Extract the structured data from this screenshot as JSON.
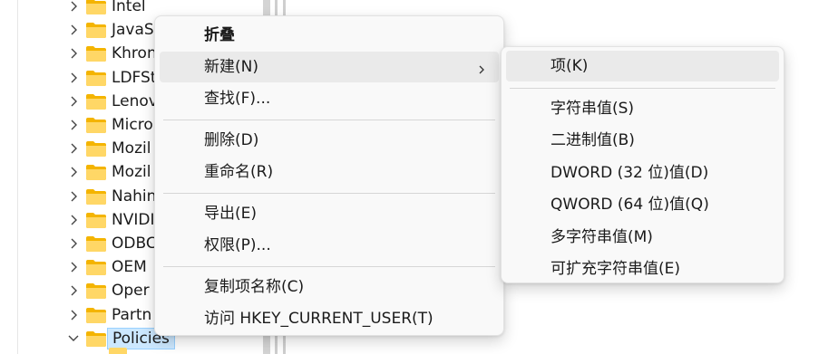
{
  "tree": {
    "items": [
      {
        "label": "Intel",
        "selected": false
      },
      {
        "label": "JavaS",
        "selected": false
      },
      {
        "label": "Khron",
        "selected": false
      },
      {
        "label": "LDFSt",
        "selected": false
      },
      {
        "label": "Lenov",
        "selected": false
      },
      {
        "label": "Micro",
        "selected": false
      },
      {
        "label": "Mozil",
        "selected": false
      },
      {
        "label": "Mozil",
        "selected": false
      },
      {
        "label": "Nahin",
        "selected": false
      },
      {
        "label": "NVIDI",
        "selected": false
      },
      {
        "label": "ODBC",
        "selected": false
      },
      {
        "label": "OEM",
        "selected": false
      },
      {
        "label": "Oper",
        "selected": false
      },
      {
        "label": "Partn",
        "selected": false
      },
      {
        "label": "Policies",
        "selected": true
      }
    ]
  },
  "context_menu": {
    "items": [
      {
        "label": "折叠",
        "bold": true
      },
      {
        "label": "新建(N)",
        "submenu": true,
        "hover": true
      },
      {
        "label": "查找(F)..."
      },
      {
        "separator": true
      },
      {
        "label": "删除(D)"
      },
      {
        "label": "重命名(R)"
      },
      {
        "separator": true
      },
      {
        "label": "导出(E)"
      },
      {
        "label": "权限(P)..."
      },
      {
        "separator": true
      },
      {
        "label": "复制项名称(C)"
      },
      {
        "label": "访问 HKEY_CURRENT_USER(T)"
      }
    ]
  },
  "submenu": {
    "items": [
      {
        "label": "项(K)",
        "hover": true
      },
      {
        "separator": true
      },
      {
        "label": "字符串值(S)"
      },
      {
        "label": "二进制值(B)"
      },
      {
        "label": "DWORD (32 位)值(D)"
      },
      {
        "label": "QWORD (64 位)值(Q)"
      },
      {
        "label": "多字符串值(M)"
      },
      {
        "label": "可扩充字符串值(E)"
      }
    ]
  },
  "icons": {
    "folder": "folder-icon",
    "chevron_collapsed": "chevron-right-icon",
    "chevron_expanded": "chevron-down-icon",
    "submenu_arrow": "chevron-right-icon"
  },
  "colors": {
    "folder": "#ffc83d",
    "selection_bg": "#cce8ff",
    "menu_bg": "#f9f9f9",
    "hover_bg": "#eaeaea"
  }
}
